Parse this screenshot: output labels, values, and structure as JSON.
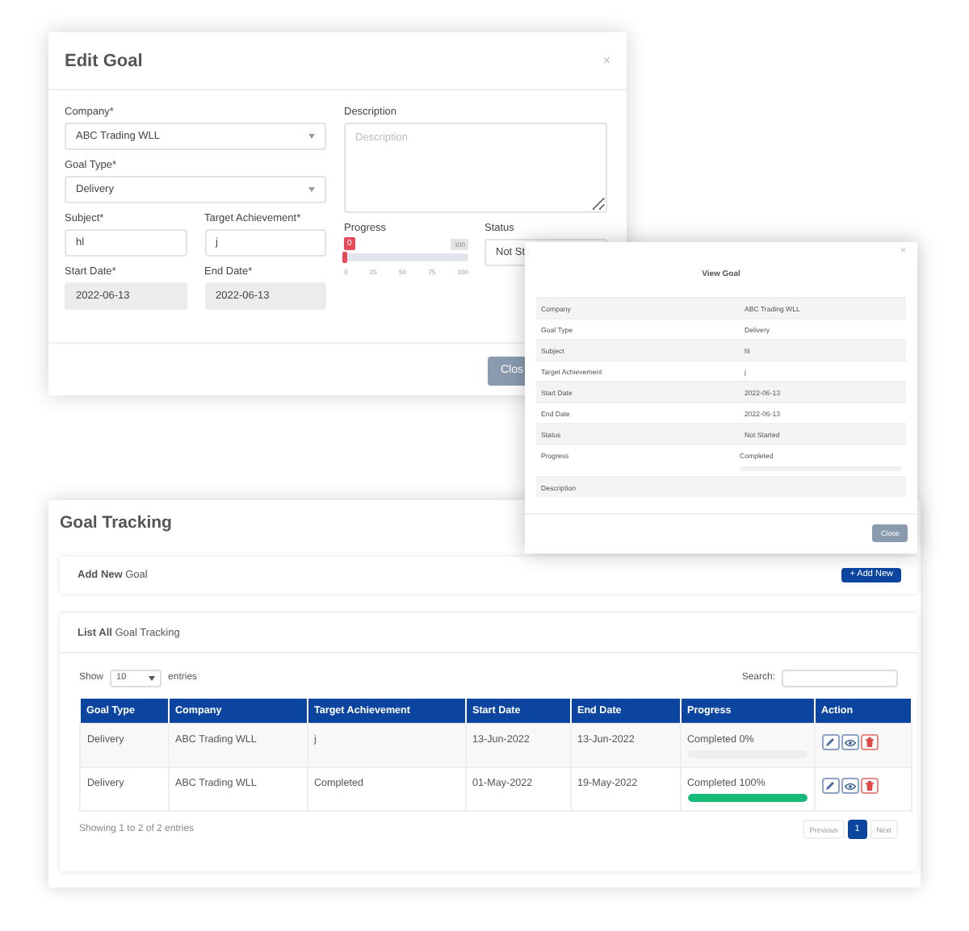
{
  "edit_goal": {
    "title": "Edit Goal",
    "close": "×",
    "company": {
      "label": "Company*",
      "value": "ABC Trading WLL"
    },
    "goal_type": {
      "label": "Goal Type*",
      "value": "Delivery"
    },
    "subject": {
      "label": "Subject*",
      "value": "hl"
    },
    "target_achievement": {
      "label": "Target Achievement*",
      "value": "j"
    },
    "start_date": {
      "label": "Start Date*",
      "value": "2022-06-13"
    },
    "end_date": {
      "label": "End Date*",
      "value": "2022-06-13"
    },
    "description": {
      "label": "Description",
      "placeholder": "Description"
    },
    "progress": {
      "label": "Progress",
      "level": 0,
      "bubble": "0",
      "max": "100",
      "ticks": [
        "0",
        "25",
        "50",
        "75",
        "100"
      ]
    },
    "status": {
      "label": "Status",
      "value": "Not St"
    },
    "close_button": "Clos"
  },
  "view_goal": {
    "title": "View Goal",
    "close": "×",
    "rows": [
      {
        "label": "Company",
        "value": "ABC Trading WLL"
      },
      {
        "label": "Goal Type",
        "value": "Delivery"
      },
      {
        "label": "Subject",
        "value": "hl"
      },
      {
        "label": "Target Achievement",
        "value": "j"
      },
      {
        "label": "Start Date",
        "value": "2022-06-13"
      },
      {
        "label": "End Date",
        "value": "2022-06-13"
      },
      {
        "label": "Status",
        "value": "Not Started"
      },
      {
        "label": "Progress",
        "value": "Completed",
        "level": 0
      },
      {
        "label": "Description"
      }
    ],
    "close_button": "Close"
  },
  "goal_tracking": {
    "title": "Goal Tracking",
    "add_card": {
      "title": "**Add New** Goal",
      "button": "+ Add New"
    },
    "list_card": {
      "title": "**List All** Goal Tracking",
      "show_label": "Show",
      "page_size": "10",
      "entries_label": "entries",
      "search_label": "Search:",
      "columns": [
        "Goal Type",
        "Company",
        "Target Achievement",
        "Start Date",
        "End Date",
        "Progress",
        "Action"
      ],
      "rows": [
        {
          "goal_type": "Delivery",
          "company": "ABC Trading WLL",
          "target": "j",
          "start": "13-Jun-2022",
          "end": "13-Jun-2022",
          "progress": "Completed 0%",
          "level": 0
        },
        {
          "goal_type": "Delivery",
          "company": "ABC Trading WLL",
          "target": "Completed",
          "start": "01-May-2022",
          "end": "19-May-2022",
          "progress": "Completed 100%",
          "level": 1
        }
      ],
      "info": "Showing 1 to 2 of 2 entries",
      "pages": [
        {
          "label": "Previous",
          "selected": false,
          "disabled": true
        },
        {
          "label": "1",
          "selected": true,
          "disabled": false
        },
        {
          "label": "Next",
          "selected": false,
          "disabled": true
        }
      ]
    }
  }
}
